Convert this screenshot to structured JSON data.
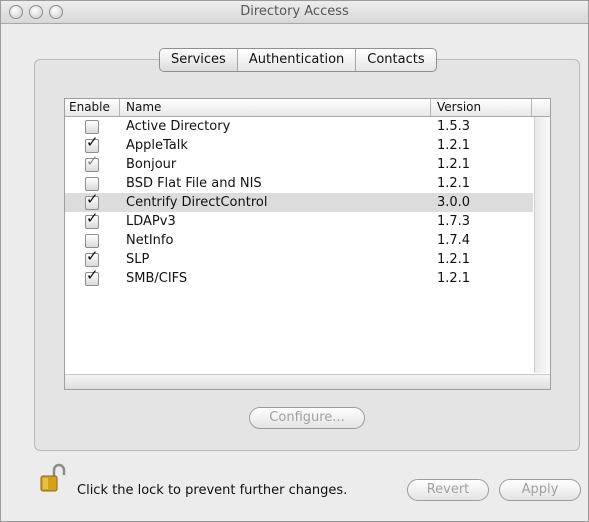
{
  "window": {
    "title": "Directory Access"
  },
  "tabs": [
    {
      "label": "Services",
      "active": true
    },
    {
      "label": "Authentication",
      "active": false
    },
    {
      "label": "Contacts",
      "active": false
    }
  ],
  "table": {
    "columns": {
      "enable": "Enable",
      "name": "Name",
      "version": "Version"
    },
    "rows": [
      {
        "enabled": false,
        "dimmed": false,
        "name": "Active Directory",
        "version": "1.5.3"
      },
      {
        "enabled": true,
        "dimmed": false,
        "name": "AppleTalk",
        "version": "1.2.1"
      },
      {
        "enabled": true,
        "dimmed": true,
        "name": "Bonjour",
        "version": "1.2.1"
      },
      {
        "enabled": false,
        "dimmed": false,
        "name": "BSD Flat File and NIS",
        "version": "1.2.1"
      },
      {
        "enabled": true,
        "dimmed": false,
        "selected": true,
        "name": "Centrify DirectControl",
        "version": "3.0.0"
      },
      {
        "enabled": true,
        "dimmed": false,
        "name": "LDAPv3",
        "version": "1.7.3"
      },
      {
        "enabled": false,
        "dimmed": false,
        "name": "NetInfo",
        "version": "1.7.4"
      },
      {
        "enabled": true,
        "dimmed": false,
        "name": "SLP",
        "version": "1.2.1"
      },
      {
        "enabled": true,
        "dimmed": false,
        "name": "SMB/CIFS",
        "version": "1.2.1"
      }
    ]
  },
  "buttons": {
    "configure": "Configure...",
    "revert": "Revert",
    "apply": "Apply"
  },
  "lock": {
    "message": "Click the lock to prevent further changes.",
    "icon": "lock-open-icon"
  },
  "colors": {
    "window_bg": "#ececec",
    "selected_row": "#dcdcdc",
    "lock_gold": "#d4a017"
  }
}
